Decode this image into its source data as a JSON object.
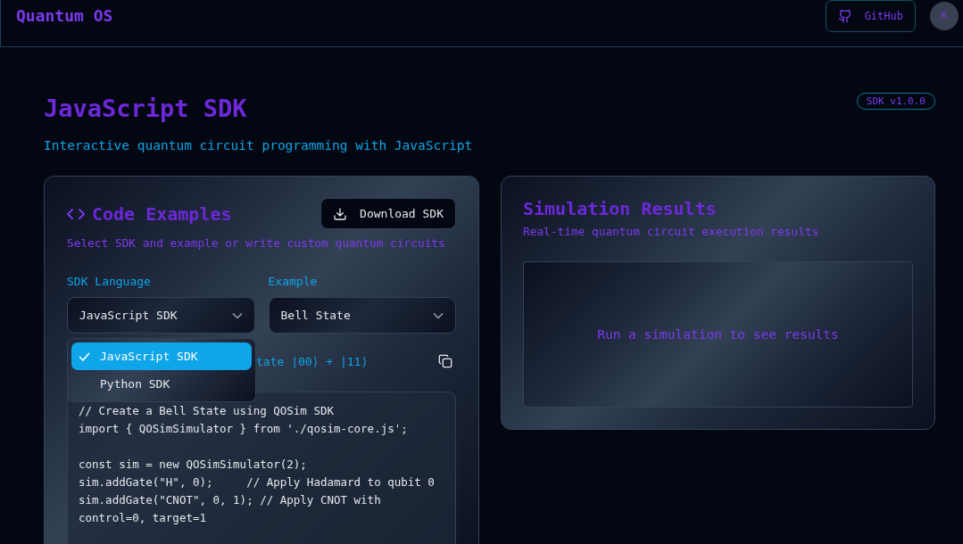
{
  "header": {
    "brand": "Quantum OS",
    "github_button": "GitHub",
    "avatar": "K"
  },
  "page": {
    "title": "JavaScript SDK",
    "subtitle": "Interactive quantum circuit programming with JavaScript",
    "version_badge": "SDK v1.0.0"
  },
  "code_panel": {
    "title": "Code Examples",
    "download_button": "Download SDK",
    "description": "Select SDK and example or write custom quantum circuits",
    "language_label": "SDK Language",
    "language_value": "JavaScript SDK",
    "example_label": "Example",
    "example_value": "Bell State",
    "language_menu": [
      {
        "label": "JavaScript SDK",
        "selected": true
      },
      {
        "label": "Python SDK",
        "selected": false
      }
    ],
    "example_description": "tate |00⟩ + |11⟩",
    "code": "// Create a Bell State using QOSim SDK\nimport { QOSimSimulator } from './qosim-core.js';\n\nconst sim = new QOSimSimulator(2);\nsim.addGate(\"H\", 0);     // Apply Hadamard to qubit 0\nsim.addGate(\"CNOT\", 0, 1); // Apply CNOT with control=0, target=1"
  },
  "results_panel": {
    "title": "Simulation Results",
    "description": "Real-time quantum circuit execution results",
    "empty_message": "Run a simulation to see results"
  }
}
